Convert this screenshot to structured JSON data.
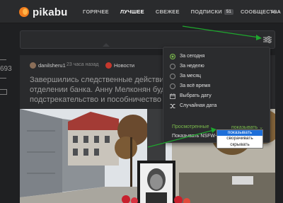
{
  "header": {
    "brand": "pikabu",
    "nav": [
      {
        "label": "ГОРЯЧЕЕ",
        "active": false
      },
      {
        "label": "ЛУЧШЕЕ",
        "active": true
      },
      {
        "label": "СВЕЖЕЕ",
        "active": false
      },
      {
        "label": "ПОДПИСКИ",
        "active": false,
        "badge": "51"
      },
      {
        "label": "СООБЩЕСТВА",
        "active": false
      }
    ]
  },
  "sidebar": {
    "rating": "693"
  },
  "story": {
    "author": "danilsheru1",
    "time": "23 часа назад",
    "community": "Новости",
    "title_lines": [
      "Завершились следственные действия",
      "отделении банка. Анну Мелконян буду",
      "подстрекательство и пособничество"
    ]
  },
  "filter_menu": {
    "period_options": [
      {
        "label": "За сегодня",
        "selected": true
      },
      {
        "label": "За неделю",
        "selected": false
      },
      {
        "label": "За месяц",
        "selected": false
      },
      {
        "label": "За всё время",
        "selected": false
      }
    ],
    "pick_date": "Выбрать дату",
    "random_date": "Случайная дата",
    "viewed_label": "Просмотренные",
    "viewed_value": "показывать",
    "nsfw_label": "Показывать NSFW-контент",
    "viewed_choices": [
      {
        "label": "показывать",
        "selected": true
      },
      {
        "label": "сворачивать",
        "selected": false
      },
      {
        "label": "скрывать",
        "selected": false
      }
    ]
  },
  "colors": {
    "accent": "#7ab94c",
    "brand": "#f07c1d",
    "annotation_arrow": "#1fa62e",
    "selection": "#1e6fd9"
  }
}
